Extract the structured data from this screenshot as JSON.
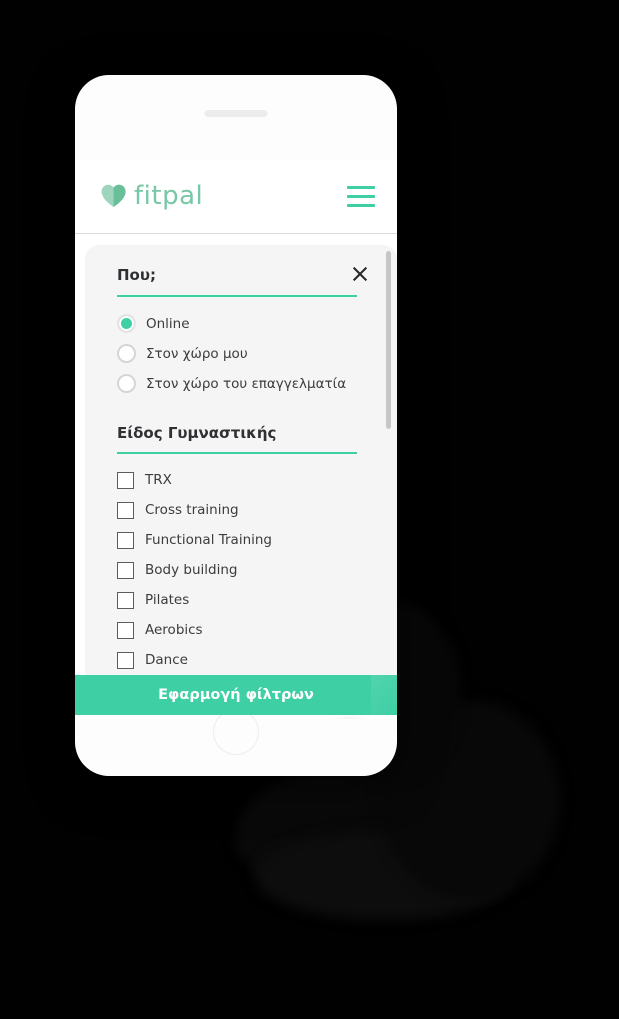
{
  "app": {
    "brand_name": "fitpal",
    "brand_icon": "heart-icon",
    "menu_icon": "hamburger-menu-icon"
  },
  "filter_panel": {
    "close_icon": "close-icon",
    "sections": [
      {
        "title": "Που;",
        "control_type": "radio",
        "options": [
          {
            "label": "Online",
            "selected": true
          },
          {
            "label": "Στον χώρο μου",
            "selected": false
          },
          {
            "label": "Στον χώρο του επαγγελματία",
            "selected": false
          }
        ]
      },
      {
        "title": "Είδος Γυμναστικής",
        "control_type": "checkbox",
        "options": [
          {
            "label": "TRX",
            "selected": false
          },
          {
            "label": "Cross training",
            "selected": false
          },
          {
            "label": "Functional Training",
            "selected": false
          },
          {
            "label": "Body building",
            "selected": false
          },
          {
            "label": "Pilates",
            "selected": false
          },
          {
            "label": "Aerobics",
            "selected": false
          },
          {
            "label": "Dance",
            "selected": false
          }
        ]
      }
    ],
    "scrollbar": {
      "visible": true
    }
  },
  "apply_button": {
    "label": "Εφαρμογή φίλτρων"
  },
  "intercom": {
    "icon": "chat-bubble-smile-icon"
  },
  "colors": {
    "accent_green": "#3ecfa5",
    "brand_green": "#78c7a6",
    "panel_bg": "#f5f5f5",
    "text_dark": "#3b3c3e",
    "page_bg": "#010101"
  }
}
